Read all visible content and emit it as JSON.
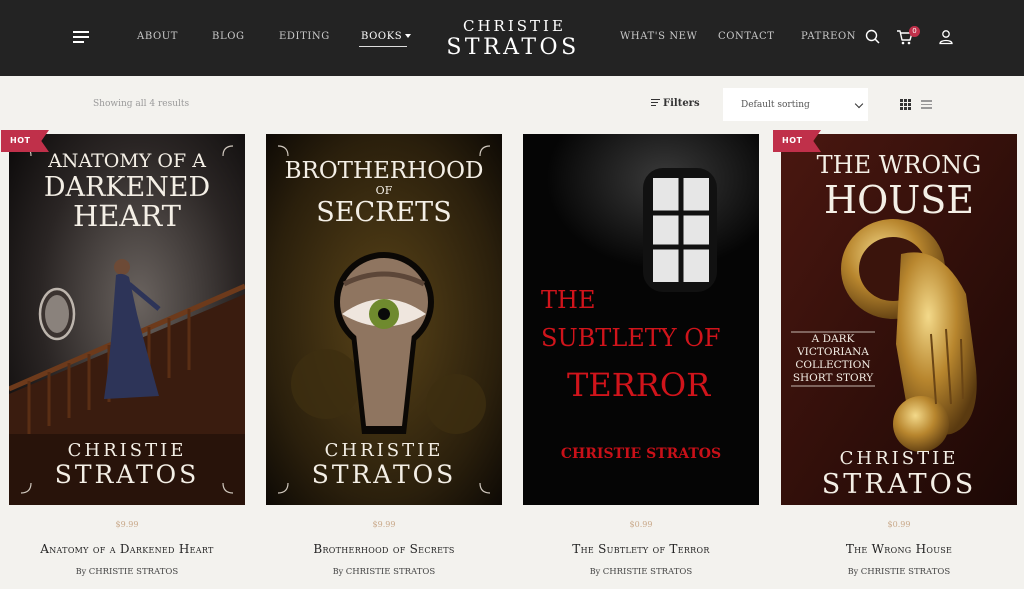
{
  "header": {
    "logo_line1": "CHRISTIE",
    "logo_line2": "STRATOS",
    "nav_left": [
      "ABOUT",
      "BLOG",
      "EDITING",
      "BOOKS"
    ],
    "nav_right": [
      "WHAT'S NEW",
      "CONTACT",
      "PATREON"
    ],
    "active_item": "BOOKS",
    "cart_count": "0"
  },
  "toolbar": {
    "results_text": "Showing all 4 results",
    "filters_label": "Filters",
    "sort_selected": "Default sorting"
  },
  "products": [
    {
      "badge": "HOT",
      "cover_title_lines": [
        "ANATOMY OF A",
        "DARKENED",
        "HEART"
      ],
      "cover_author_lines": [
        "CHRISTIE",
        "STRATOS"
      ],
      "price": "$9.99",
      "title": "Anatomy of a Darkened Heart",
      "by": "By",
      "author": "CHRISTIE STRATOS"
    },
    {
      "badge": "",
      "cover_title_lines": [
        "BROTHERHOOD",
        "OF",
        "SECRETS"
      ],
      "cover_author_lines": [
        "CHRISTIE",
        "STRATOS"
      ],
      "price": "$9.99",
      "title": "Brotherhood of Secrets",
      "by": "By",
      "author": "CHRISTIE STRATOS"
    },
    {
      "badge": "",
      "cover_title_lines": [
        "THE",
        "SUBTLETY OF",
        "TERROR"
      ],
      "cover_author_lines": [
        "CHRISTIE STRATOS"
      ],
      "price": "$0.99",
      "title": "The Subtlety of Terror",
      "by": "By",
      "author": "CHRISTIE STRATOS"
    },
    {
      "badge": "HOT",
      "cover_title_lines": [
        "THE WRONG",
        "HOUSE"
      ],
      "cover_subtitle_lines": [
        "A DARK",
        "VICTORIANA",
        "COLLECTION",
        "SHORT STORY"
      ],
      "cover_author_lines": [
        "CHRISTIE",
        "STRATOS"
      ],
      "price": "$0.99",
      "title": "The Wrong House",
      "by": "By",
      "author": "CHRISTIE STRATOS"
    }
  ],
  "colors": {
    "header_bg": "#232323",
    "page_bg": "#f3f2ee",
    "badge": "#c0304a",
    "price": "#c9a98a",
    "terror_red": "#d0141b"
  },
  "icons": [
    "menu-icon",
    "search-icon",
    "cart-icon",
    "user-icon",
    "filter-icon",
    "grid-view-icon",
    "list-view-icon"
  ]
}
